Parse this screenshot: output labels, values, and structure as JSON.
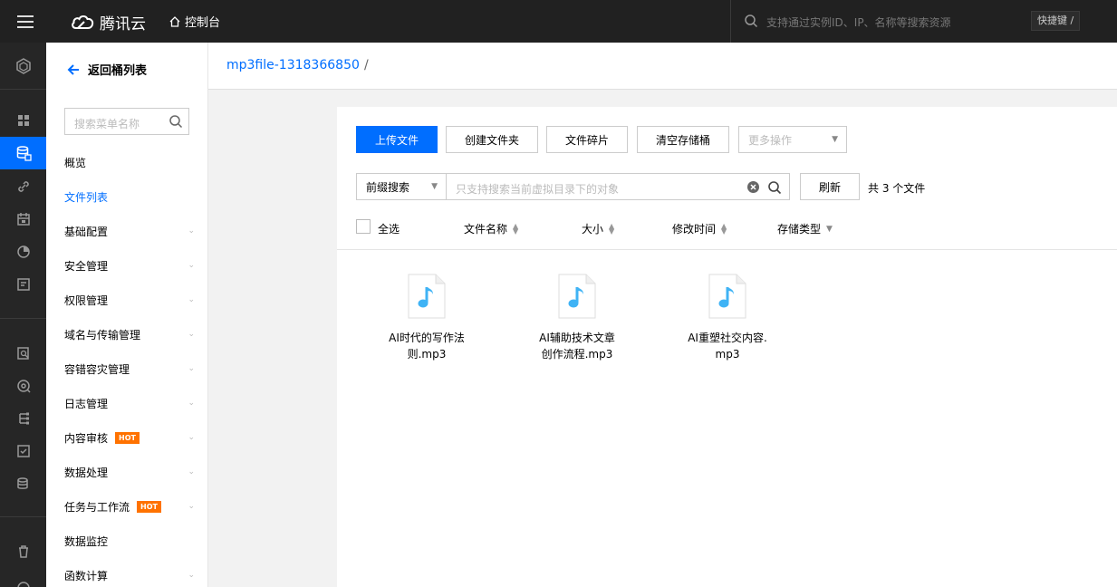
{
  "topbar": {
    "brand": "腾讯云",
    "console": "控制台",
    "search_placeholder": "支持通过实例ID、IP、名称等搜索资源",
    "shortcut": "快捷键 /"
  },
  "sidebar": {
    "back_label": "返回桶列表",
    "search_placeholder": "搜索菜单名称",
    "items": [
      {
        "label": "概览",
        "chevron": false,
        "hot": false,
        "active": false
      },
      {
        "label": "文件列表",
        "chevron": false,
        "hot": false,
        "active": true
      },
      {
        "label": "基础配置",
        "chevron": true,
        "hot": false,
        "active": false
      },
      {
        "label": "安全管理",
        "chevron": true,
        "hot": false,
        "active": false
      },
      {
        "label": "权限管理",
        "chevron": true,
        "hot": false,
        "active": false
      },
      {
        "label": "域名与传输管理",
        "chevron": true,
        "hot": false,
        "active": false
      },
      {
        "label": "容错容灾管理",
        "chevron": true,
        "hot": false,
        "active": false
      },
      {
        "label": "日志管理",
        "chevron": true,
        "hot": false,
        "active": false
      },
      {
        "label": "内容审核",
        "chevron": true,
        "hot": true,
        "active": false
      },
      {
        "label": "数据处理",
        "chevron": true,
        "hot": false,
        "active": false
      },
      {
        "label": "任务与工作流",
        "chevron": true,
        "hot": true,
        "active": false
      },
      {
        "label": "数据监控",
        "chevron": false,
        "hot": false,
        "active": false
      },
      {
        "label": "函数计算",
        "chevron": true,
        "hot": false,
        "active": false
      }
    ],
    "hot_label": "HOT"
  },
  "breadcrumb": {
    "bucket": "mp3file-1318366850",
    "separator": "/"
  },
  "toolbar": {
    "upload": "上传文件",
    "create_folder": "创建文件夹",
    "fragments": "文件碎片",
    "clear_bucket": "清空存储桶",
    "more_actions": "更多操作"
  },
  "filter": {
    "type": "前缀搜索",
    "placeholder": "只支持搜索当前虚拟目录下的对象",
    "refresh": "刷新",
    "count_text": "共 3 个文件"
  },
  "list_header": {
    "select_all": "全选",
    "name": "文件名称",
    "size": "大小",
    "modified": "修改时间",
    "storage_class": "存储类型"
  },
  "files": [
    {
      "line1": "AI时代的写作法",
      "line2": "则.mp3"
    },
    {
      "line1": "AI辅助技术文章",
      "line2": "创作流程.mp3"
    },
    {
      "line1": "AI重塑社交内容.",
      "line2": "mp3"
    }
  ],
  "colors": {
    "accent": "#006eff",
    "topbar": "#212121",
    "rail": "#262626",
    "hot": "#ff7200",
    "music_icon": "#3fb3f5"
  }
}
